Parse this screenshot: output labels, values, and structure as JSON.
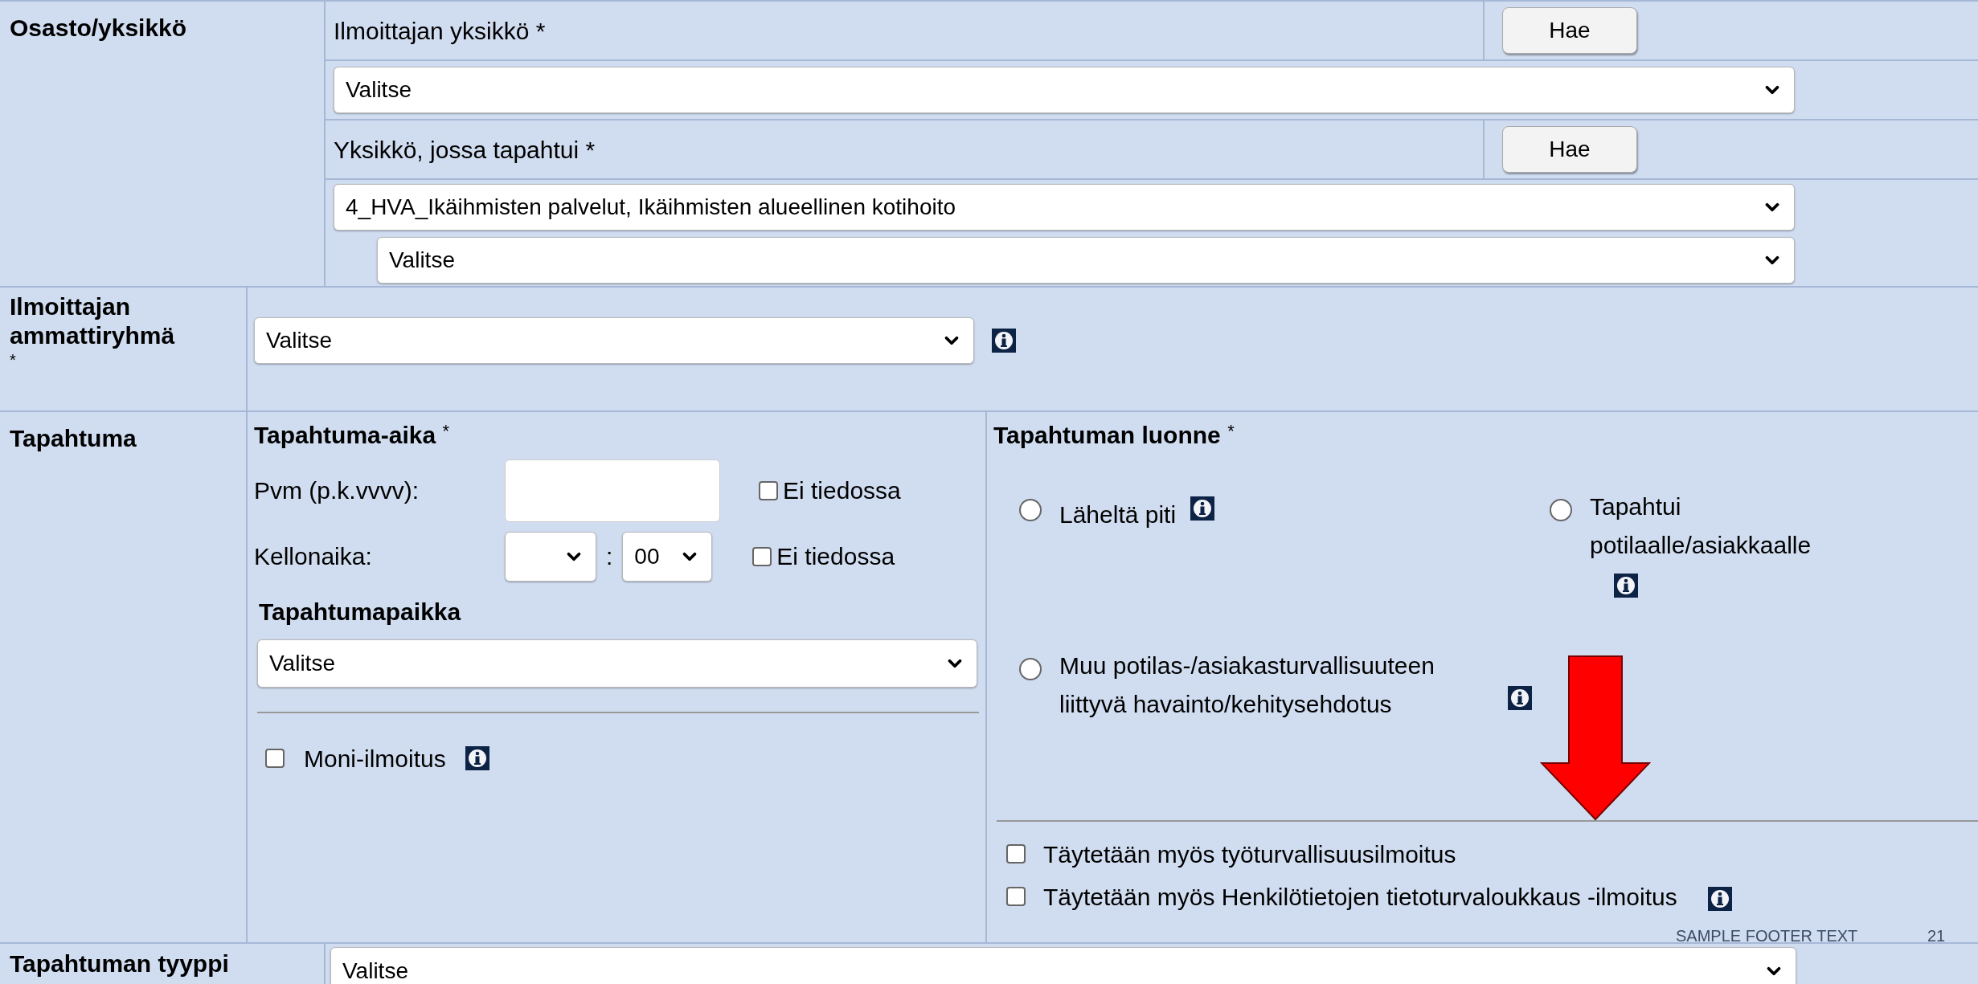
{
  "unit_section": {
    "label": "Osasto/yksikkö",
    "reporter_unit": {
      "label": "Ilmoittajan yksikkö *",
      "button": "Hae",
      "select": "Valitse"
    },
    "event_unit": {
      "label": "Yksikkö, jossa tapahtui *",
      "button": "Hae",
      "select": "4_HVA_Ikäihmisten palvelut, Ikäihmisten alueellinen kotihoito",
      "sub_select": "Valitse"
    }
  },
  "profession": {
    "label": "Ilmoittajan ammattiryhmä",
    "required_mark": "*",
    "select": "Valitse"
  },
  "event": {
    "label": "Tapahtuma",
    "time": {
      "heading": "Tapahtuma-aika",
      "required_mark": "*",
      "date_label": "Pvm (p.k.vvvv):",
      "time_label": "Kellonaika:",
      "colon": ":",
      "minute": "00",
      "unknown": [
        {
          "label": "Ei tiedossa",
          "checked": false
        },
        {
          "label": "Ei tiedossa",
          "checked": false
        }
      ]
    },
    "place": {
      "heading": "Tapahtumapaikka",
      "select": "Valitse"
    },
    "multi": {
      "label": "Moni-ilmoitus",
      "checked": false
    }
  },
  "nature": {
    "heading": "Tapahtuman luonne",
    "required_mark": "*",
    "options": [
      {
        "label": "Läheltä piti",
        "selected": false
      },
      {
        "label": "Tapahtui potilaalle/asiakkaalle",
        "selected": false
      },
      {
        "label": "Muu potilas-/asiakasturvallisuuteen liittyvä havainto/kehitysehdotus",
        "selected": false
      }
    ],
    "extra_checks": [
      {
        "label": "Täytetään myös työturvallisuusilmoitus",
        "checked": false,
        "info": false
      },
      {
        "label": "Täytetään myös Henkilötietojen tietoturvaloukkaus -ilmoitus",
        "checked": false,
        "info": true
      }
    ]
  },
  "event_type": {
    "label": "Tapahtuman tyyppi",
    "select": "Valitse"
  },
  "footer": {
    "text": "SAMPLE FOOTER TEXT",
    "page": "21"
  }
}
